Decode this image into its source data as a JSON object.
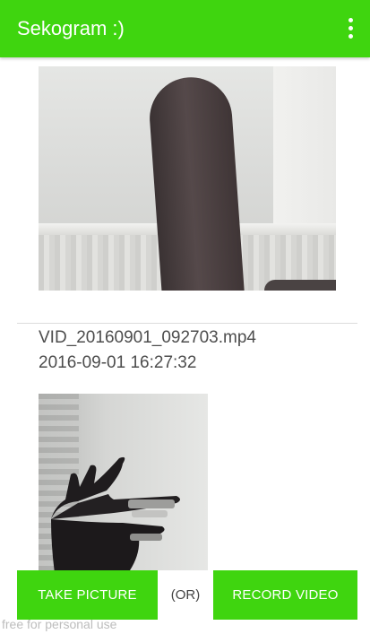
{
  "app_bar": {
    "title": "Sekogram :)",
    "menu_icon": "more-vert-icon",
    "color": "#3fd50f"
  },
  "media_list": [
    {
      "type": "video",
      "file_name": "VID_20160901_092703.mp4",
      "date": "2016-09-01 16:27:32"
    },
    {
      "type": "image"
    }
  ],
  "actions": {
    "take_picture_label": "TAKE PICTURE",
    "or_label": "(OR)",
    "record_video_label": "RECORD VIDEO"
  },
  "watermark": "free for personal use"
}
